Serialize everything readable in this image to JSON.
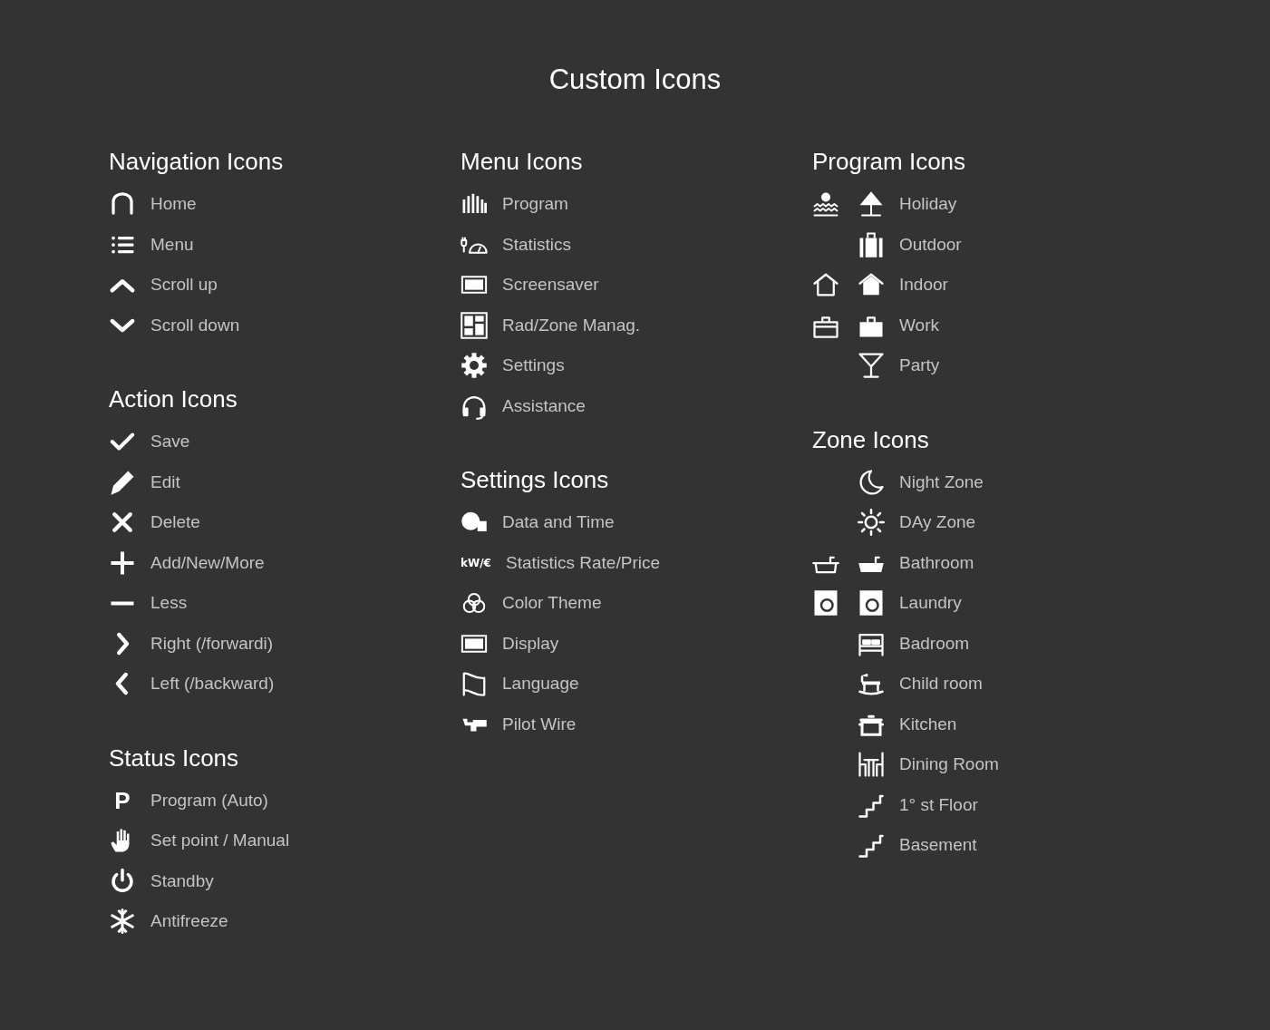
{
  "title": "Custom Icons",
  "columns": [
    [
      {
        "heading": "Navigation Icons",
        "items": [
          {
            "icons": [
              {
                "kind": "arch"
              }
            ],
            "label": "Home"
          },
          {
            "icons": [
              {
                "kind": "list"
              }
            ],
            "label": "Menu"
          },
          {
            "icons": [
              {
                "kind": "chevron-up"
              }
            ],
            "label": "Scroll up"
          },
          {
            "icons": [
              {
                "kind": "chevron-down"
              }
            ],
            "label": "Scroll down"
          }
        ]
      },
      {
        "heading": "Action Icons",
        "items": [
          {
            "icons": [
              {
                "kind": "check"
              }
            ],
            "label": "Save"
          },
          {
            "icons": [
              {
                "kind": "pencil"
              }
            ],
            "label": "Edit"
          },
          {
            "icons": [
              {
                "kind": "x"
              }
            ],
            "label": "Delete"
          },
          {
            "icons": [
              {
                "kind": "plus"
              }
            ],
            "label": "Add/New/More"
          },
          {
            "icons": [
              {
                "kind": "minus"
              }
            ],
            "label": "Less"
          },
          {
            "icons": [
              {
                "kind": "chevron-right"
              }
            ],
            "label": "Right (/forwardi)"
          },
          {
            "icons": [
              {
                "kind": "chevron-left"
              }
            ],
            "label": "Left (/backward)"
          }
        ]
      },
      {
        "heading": "Status Icons",
        "items": [
          {
            "glyph": "P",
            "label": "Program (Auto)"
          },
          {
            "icons": [
              {
                "kind": "hand"
              }
            ],
            "label": "Set point / Manual"
          },
          {
            "icons": [
              {
                "kind": "power"
              }
            ],
            "label": "Standby"
          },
          {
            "icons": [
              {
                "kind": "snowflake"
              }
            ],
            "label": "Antifreeze"
          }
        ]
      }
    ],
    [
      {
        "heading": "Menu Icons",
        "items": [
          {
            "icons": [
              {
                "kind": "bars"
              }
            ],
            "label": "Program"
          },
          {
            "icons": [
              {
                "kind": "gauge"
              }
            ],
            "label": "Statistics"
          },
          {
            "icons": [
              {
                "kind": "screen"
              }
            ],
            "label": "Screensaver"
          },
          {
            "icons": [
              {
                "kind": "grid"
              }
            ],
            "label": "Rad/Zone Manag."
          },
          {
            "icons": [
              {
                "kind": "gear"
              }
            ],
            "label": "Settings"
          },
          {
            "icons": [
              {
                "kind": "headset"
              }
            ],
            "label": "Assistance"
          }
        ]
      },
      {
        "heading": "Settings Icons",
        "items": [
          {
            "icons": [
              {
                "kind": "moon-checker"
              }
            ],
            "label": "Data and Time"
          },
          {
            "glyph": "kW/€",
            "label": "Statistics Rate/Price"
          },
          {
            "icons": [
              {
                "kind": "circles"
              }
            ],
            "label": "Color Theme"
          },
          {
            "icons": [
              {
                "kind": "screen"
              }
            ],
            "label": "Display"
          },
          {
            "icons": [
              {
                "kind": "flag"
              }
            ],
            "label": "Language"
          },
          {
            "icons": [
              {
                "kind": "plug"
              }
            ],
            "label": "Pilot Wire"
          }
        ]
      }
    ],
    [
      {
        "heading": "Program Icons",
        "items": [
          {
            "icons": [
              {
                "kind": "sun-sea"
              },
              {
                "kind": "umbrella"
              }
            ],
            "label": "Holiday"
          },
          {
            "icons": [
              {
                "kind": "suitcase"
              }
            ],
            "label": "Outdoor"
          },
          {
            "icons": [
              {
                "kind": "house-outline"
              },
              {
                "kind": "house-filled"
              }
            ],
            "label": "Indoor"
          },
          {
            "icons": [
              {
                "kind": "bag-outline"
              },
              {
                "kind": "bag-filled"
              }
            ],
            "label": "Work"
          },
          {
            "icons": [
              {
                "kind": "glass"
              }
            ],
            "label": "Party"
          }
        ]
      },
      {
        "heading": "Zone Icons",
        "items": [
          {
            "icons": [
              {
                "kind": "moon"
              }
            ],
            "label": "Night Zone"
          },
          {
            "icons": [
              {
                "kind": "sun"
              }
            ],
            "label": "DAy Zone"
          },
          {
            "icons": [
              {
                "kind": "tub-outline"
              },
              {
                "kind": "tub-filled"
              }
            ],
            "label": "Bathroom"
          },
          {
            "icons": [
              {
                "kind": "washer"
              },
              {
                "kind": "washer"
              }
            ],
            "label": "Laundry"
          },
          {
            "icons": [
              {
                "kind": "bed"
              }
            ],
            "label": "Badroom"
          },
          {
            "icons": [
              {
                "kind": "rocking-horse"
              }
            ],
            "label": "Child room"
          },
          {
            "icons": [
              {
                "kind": "pot"
              }
            ],
            "label": "Kitchen"
          },
          {
            "icons": [
              {
                "kind": "table-chairs"
              }
            ],
            "label": "Dining Room"
          },
          {
            "icons": [
              {
                "kind": "stairs"
              }
            ],
            "label": "1° st Floor"
          },
          {
            "icons": [
              {
                "kind": "stairs"
              }
            ],
            "label": "Basement"
          }
        ]
      }
    ]
  ]
}
